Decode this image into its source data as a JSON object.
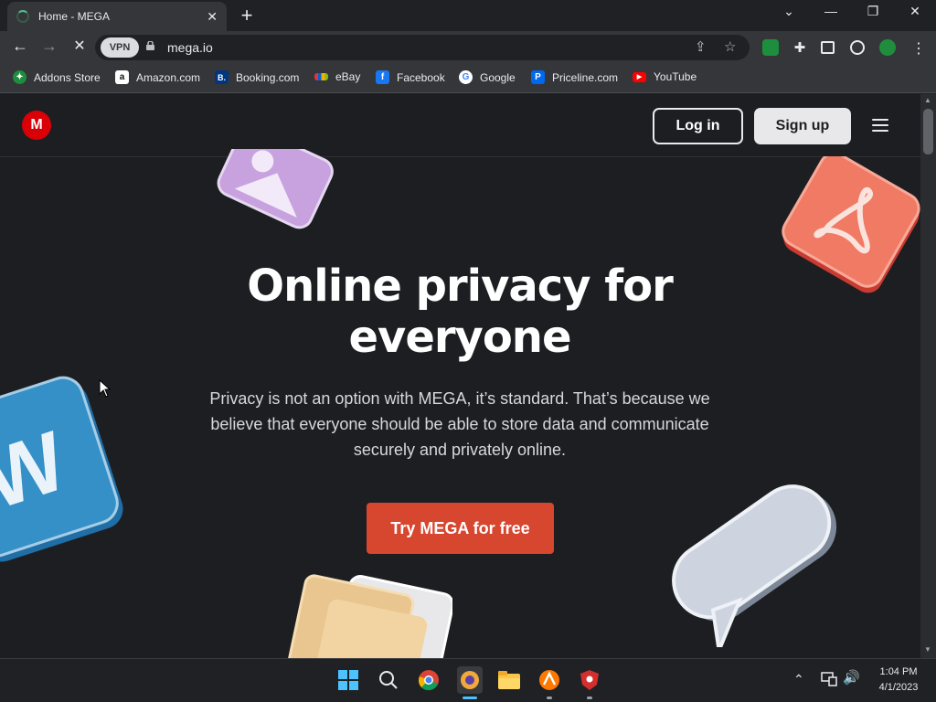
{
  "browser": {
    "tab_title": "Home - MEGA",
    "url": "mega.io",
    "vpn_label": "VPN",
    "bookmarks": [
      {
        "label": "Addons Store",
        "icon": "addons-store-icon",
        "color": "#1e8e3e",
        "glyph": "✦"
      },
      {
        "label": "Amazon.com",
        "icon": "amazon-icon",
        "color": "#ffffff",
        "glyph": "a"
      },
      {
        "label": "Booking.com",
        "icon": "booking-icon",
        "color": "#003580",
        "glyph": "B."
      },
      {
        "label": "eBay",
        "icon": "ebay-icon",
        "color": "#86b817",
        "glyph": ""
      },
      {
        "label": "Facebook",
        "icon": "facebook-icon",
        "color": "#1877f2",
        "glyph": "f"
      },
      {
        "label": "Google",
        "icon": "google-icon",
        "color": "#ffffff",
        "glyph": "G"
      },
      {
        "label": "Priceline.com",
        "icon": "priceline-icon",
        "color": "#0068ef",
        "glyph": "P"
      },
      {
        "label": "YouTube",
        "icon": "youtube-icon",
        "color": "#ff0000",
        "glyph": "▶"
      }
    ]
  },
  "site": {
    "logo_letter": "M",
    "login_label": "Log in",
    "signup_label": "Sign up",
    "hero_title_line1": "Online privacy for",
    "hero_title_line2": "everyone",
    "hero_text_line1": "Privacy is not an option with MEGA, it’s standard. That’s because we",
    "hero_text_line2": "believe that everyone should be able to store data and communicate",
    "hero_text_line3": "securely and privately online.",
    "cta_label": "Try MEGA for free"
  },
  "taskbar": {
    "time": "1:04 PM",
    "date": "4/1/2023"
  },
  "colors": {
    "brand_red": "#d90007",
    "cta_red": "#d7462f",
    "page_bg": "#1d1e22"
  }
}
